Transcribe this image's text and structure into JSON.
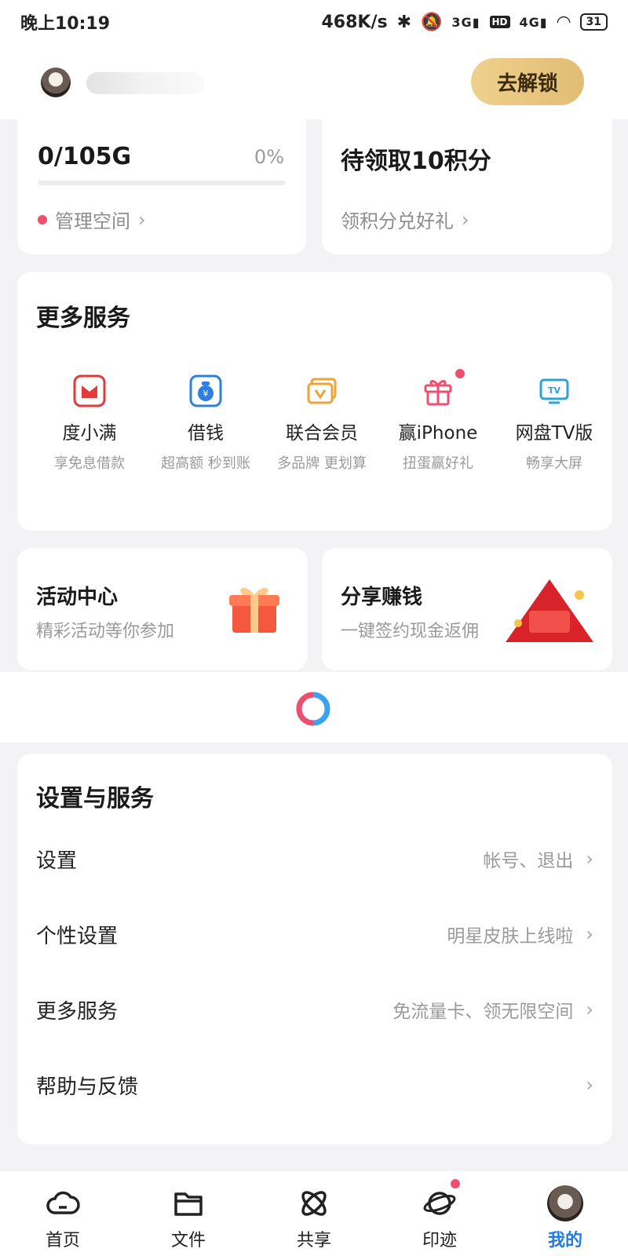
{
  "status_bar": {
    "time": "晚上10:19",
    "speed": "468K/s",
    "net1": "3G",
    "hd": "HD",
    "net2": "4G",
    "battery": "31"
  },
  "header": {
    "unlock_label": "去解锁"
  },
  "storage": {
    "used": "0/105G",
    "percent_text": "0%",
    "percent_value": 0,
    "manage_label": "管理空间"
  },
  "points": {
    "title": "待领取10积分",
    "link": "领积分兑好礼"
  },
  "more_services": {
    "title": "更多服务",
    "items": [
      {
        "name": "度小满",
        "sub": "享免息借款",
        "icon": "duxiaoman-icon"
      },
      {
        "name": "借钱",
        "sub": "超高额 秒到账",
        "icon": "money-bag-icon"
      },
      {
        "name": "联合会员",
        "sub": "多品牌 更划算",
        "icon": "vip-card-icon"
      },
      {
        "name": "赢iPhone",
        "sub": "扭蛋赢好礼",
        "icon": "gift-box-icon"
      },
      {
        "name": "网盘TV版",
        "sub": "畅享大屏",
        "icon": "tv-icon"
      }
    ]
  },
  "promos": [
    {
      "title": "活动中心",
      "sub": "精彩活动等你参加"
    },
    {
      "title": "分享赚钱",
      "sub": "一键签约现金返佣"
    }
  ],
  "settings": {
    "title": "设置与服务",
    "rows": [
      {
        "label": "设置",
        "detail": "帐号、退出"
      },
      {
        "label": "个性设置",
        "detail": "明星皮肤上线啦"
      },
      {
        "label": "更多服务",
        "detail": "免流量卡、领无限空间"
      },
      {
        "label": "帮助与反馈",
        "detail": ""
      }
    ]
  },
  "bottom_nav": [
    {
      "label": "首页"
    },
    {
      "label": "文件"
    },
    {
      "label": "共享"
    },
    {
      "label": "印迹"
    },
    {
      "label": "我的"
    }
  ],
  "colors": {
    "accent_pink": "#ef4f6e",
    "accent_blue": "#1f7be6",
    "gold": "#e1bd74"
  }
}
